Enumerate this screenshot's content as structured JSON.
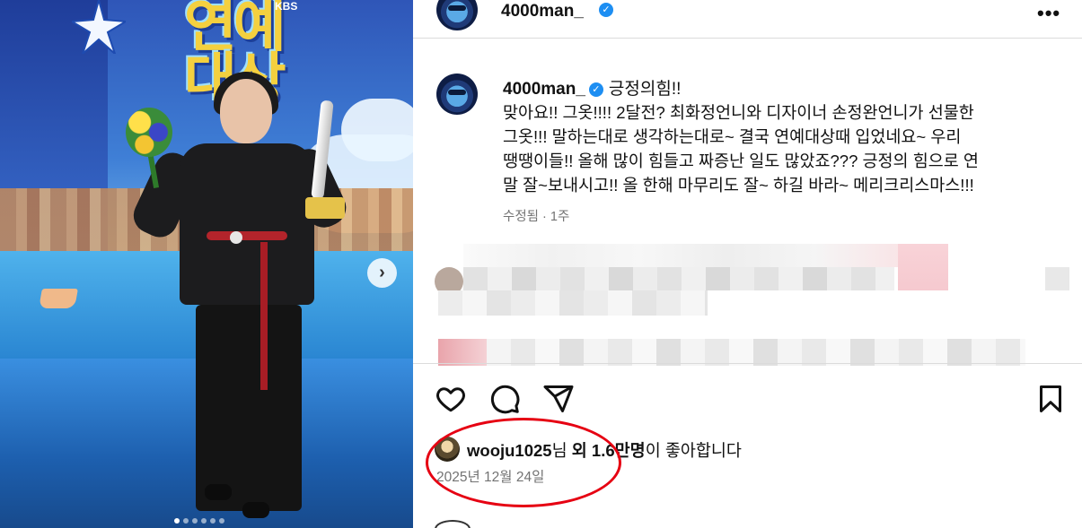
{
  "post": {
    "username": "4000man_",
    "verified_mark": "✓",
    "more_label": "•••"
  },
  "caption": {
    "username": "4000man_",
    "title": "긍정의힘!!",
    "text": "맞아요!! 그옷!!!! 2달전? 최화정언니와 디자이너 손정완언니가 선물한\n그옷!!! 말하는대로 생각하는대로~ 결국 연예대상때 입었네요~ 우리\n땡땡이들!! 올해 많이 힘들고 짜증난 일도 많았죠??? 긍정의 힘으로 연\n말 잘~보내시고!! 올 한해 마무리도 잘~ 하길 바라~ 메리크리스마스!!!",
    "meta": "수정됨 · 1주"
  },
  "photo": {
    "logo_main": "연예\n대상",
    "logo_kbs": "KBS",
    "next_label": "›",
    "dots": 6,
    "active_dot": 0
  },
  "likes": {
    "liker": "wooju1025",
    "suffix1": "님 ",
    "bold_part": "외 1.6만명",
    "suffix2": "이 좋아합니다"
  },
  "date": "2025년 12월 24일",
  "icons": {
    "like": "heart-icon",
    "comment": "comment-icon",
    "share": "share-icon",
    "save": "bookmark-icon",
    "more": "more-icon",
    "next": "chevron-right-icon",
    "verified": "verified-icon"
  },
  "colors": {
    "verified_blue": "#1d8ef2",
    "annotation_red": "#e60012",
    "meta_gray": "#737373"
  }
}
